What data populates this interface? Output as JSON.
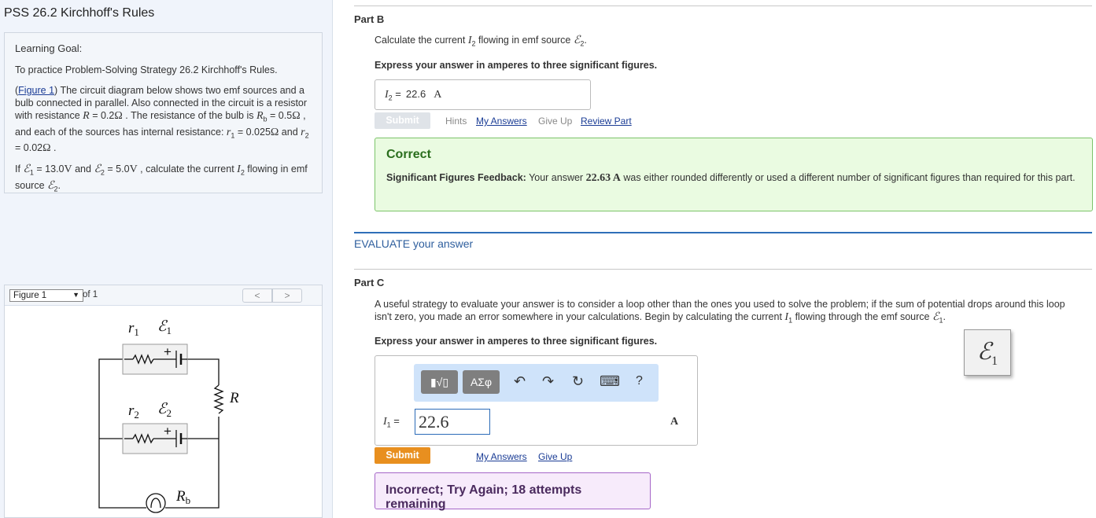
{
  "page": {
    "title": "PSS 26.2 Kirchhoff's Rules"
  },
  "goal": {
    "heading": "Learning Goal:",
    "intro": "To practice Problem-Solving Strategy 26.2 Kirchhoff's Rules.",
    "figure_link": "Figure 1",
    "p2_a": ") The circuit diagram below shows two emf sources and a bulb connected in parallel. Also connected in the circuit is a resistor with resistance ",
    "p2_R": "R",
    "p2_b": " = 0.2",
    "p2_c": " . The resistance of the bulb is ",
    "p2_Rb": "R",
    "p2_Rb_sub": "b",
    "p2_d": " = 0.5",
    "p2_e": " , and each of the sources has internal resistance: ",
    "p2_r1": "r",
    "p2_r1_sub": "1",
    "p2_f": " = 0.025",
    "p2_g": " and ",
    "p2_r2": "r",
    "p2_r2_sub": "2",
    "p2_h": " = 0.02",
    "p2_i": " .",
    "ohm": "Ω",
    "p3_a": "If ",
    "p3_E1": "ℰ",
    "p3_E1_sub": "1",
    "p3_b": " = 13.0",
    "p3_V1": "V",
    "p3_c": " and ",
    "p3_E2": "ℰ",
    "p3_E2_sub": "2",
    "p3_d": " = 5.0",
    "p3_V2": "V",
    "p3_e": " , calculate the current ",
    "p3_I2": "I",
    "p3_I2_sub": "2",
    "p3_f": " flowing in emf source ",
    "p3_E2b": "ℰ",
    "p3_E2b_sub": "2",
    "p3_g": "."
  },
  "figure": {
    "select_value": "Figure 1",
    "of_text": "of 1",
    "prev": "<",
    "next": ">",
    "labels": {
      "r1": "r",
      "r1_sub": "1",
      "E1": "ℰ",
      "E1_sub": "1",
      "r2": "r",
      "r2_sub": "2",
      "E2": "ℰ",
      "E2_sub": "2",
      "R": "R",
      "Rb": "R",
      "Rb_sub": "b",
      "plus": "+"
    }
  },
  "partB": {
    "label": "Part B",
    "q_a": "Calculate the current ",
    "q_I": "I",
    "q_I_sub": "2",
    "q_b": " flowing in emf source ",
    "q_E": "ℰ",
    "q_E_sub": "2",
    "q_c": ".",
    "instruction": "Express your answer in amperes to three significant figures.",
    "answer_var": "I",
    "answer_var_sub": "2",
    "answer_eq": " =",
    "answer_value": "22.6",
    "answer_unit": "A",
    "submit": "Submit",
    "hints": "Hints",
    "my_answers": "My Answers",
    "give_up": "Give Up",
    "review_part": "Review Part"
  },
  "correct": {
    "title": "Correct",
    "bold_lead": "Significant Figures Feedback:",
    "text_a": " Your answer ",
    "value": "22.63 A",
    "text_b": " was either rounded differently or used a different number of significant figures than required for this part."
  },
  "evaluate": {
    "label": "EVALUATE your answer"
  },
  "partC": {
    "label": "Part C",
    "q_a": "A useful strategy to evaluate your answer is to consider a loop other than the ones you used to solve the problem; if the sum of potential drops around this loop isn't zero, you made an error somewhere in your calculations. Begin by calculating the current ",
    "q_I": "I",
    "q_I_sub": "1",
    "q_b": " flowing through the emf source ",
    "q_E": "ℰ",
    "q_E_sub": "1",
    "q_c": ".",
    "instruction": "Express your answer in amperes to three significant figures.",
    "toolbar": {
      "templates": "▮√▯",
      "symbols": "ΑΣφ",
      "undo": "↶",
      "redo": "↷",
      "reset": "↻",
      "keyboard": "⌨",
      "help": "?"
    },
    "answer_var": "I",
    "answer_var_sub": "1",
    "answer_eq": " =",
    "answer_value": "22.6",
    "answer_unit": "A",
    "submit": "Submit",
    "my_answers": "My Answers",
    "give_up": "Give Up",
    "feedback": "Incorrect; Try Again; 18 attempts remaining"
  },
  "tooltip": {
    "symbol": "ℰ",
    "sub": "1"
  },
  "colors": {
    "correct_border": "#7cc46a",
    "incorrect_border": "#a566c8",
    "submit_active": "#e88f1f",
    "link": "#1a3c95",
    "evaluate": "#2f6fb8"
  }
}
